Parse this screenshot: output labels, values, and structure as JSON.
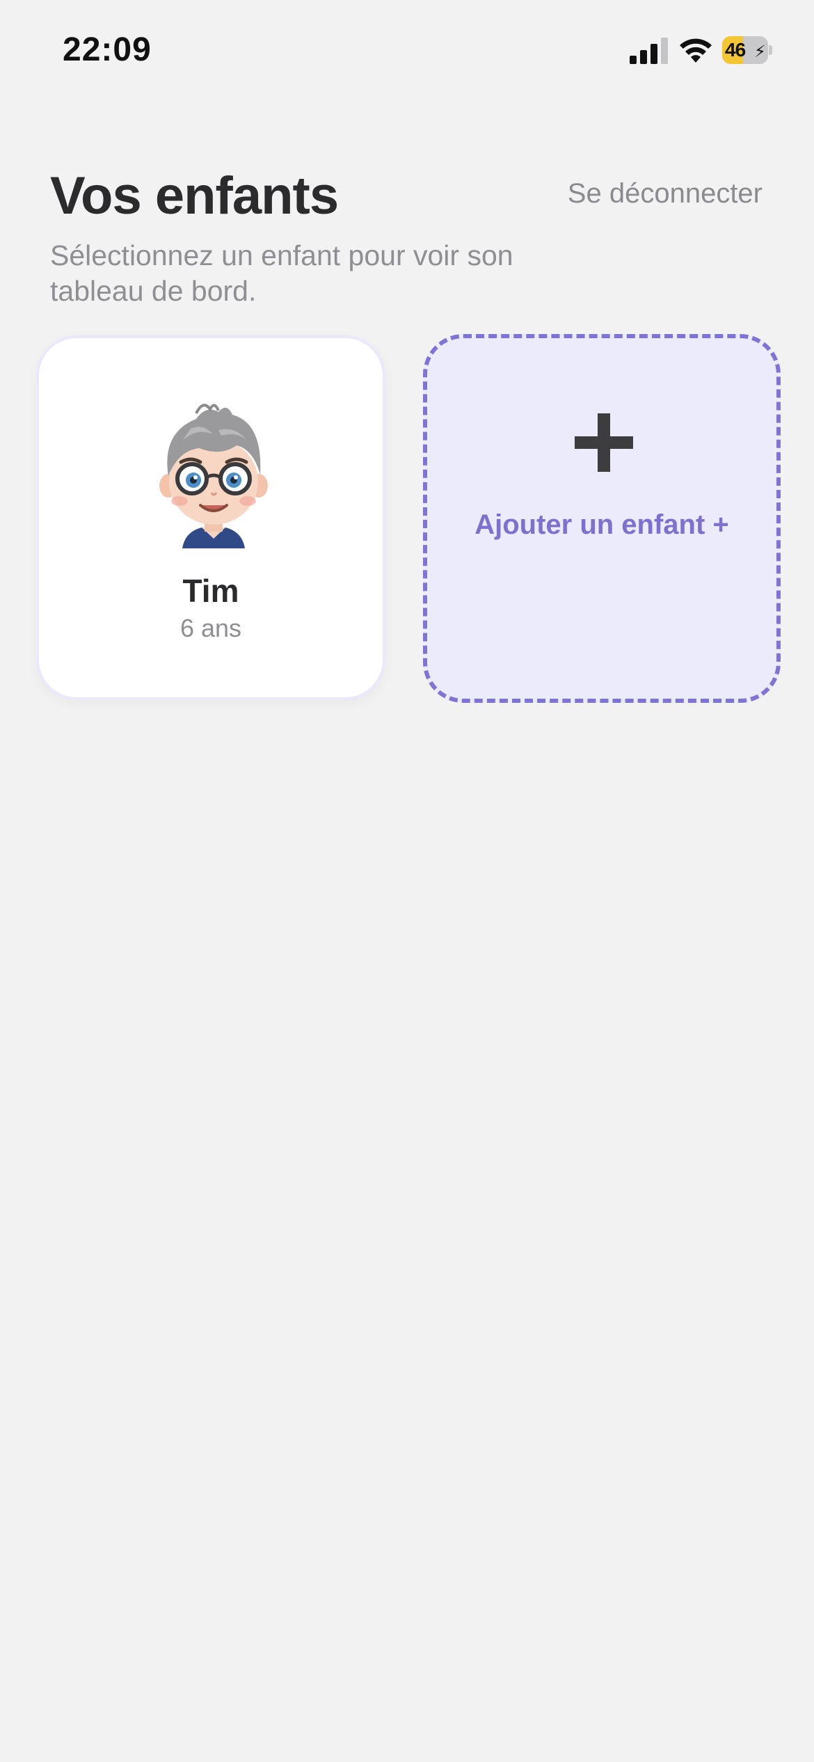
{
  "status_bar": {
    "time": "22:09",
    "battery_level": "46",
    "battery_fraction": 0.46,
    "battery_charging": true,
    "signal_bars": 3,
    "signal_max": 4,
    "icons": [
      "cellular-signal-icon",
      "wifi-icon",
      "battery-charging-icon"
    ]
  },
  "header": {
    "title": "Vos enfants",
    "logout_label": "Se déconnecter",
    "subtitle": "Sélectionnez un enfant pour voir son tableau de bord."
  },
  "children": [
    {
      "name": "Tim",
      "age": "6 ans",
      "avatar_icon": "child-avatar-glasses"
    }
  ],
  "add_child": {
    "icon": "plus-icon",
    "label": "Ajouter un enfant +"
  },
  "colors": {
    "background": "#f2f2f3",
    "accent": "#7f73d6",
    "accent_light_bg": "#ecebfc",
    "title_text": "#2b2b2d",
    "secondary_text": "#8e8e93",
    "battery_yellow": "#f5c634"
  }
}
